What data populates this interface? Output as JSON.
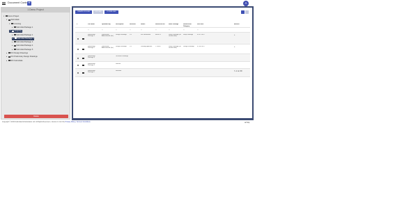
{
  "header": {
    "title": "Document Control",
    "add_label": "+",
    "avatar_initial": "A"
  },
  "tree": {
    "project_title": "1 Demo Project",
    "nodes": [
      {
        "label": "Demo Project",
        "expanded": true
      },
      {
        "label": "Submittals",
        "expanded": true
      },
      {
        "label": "Incoming",
        "expanded": true
      },
      {
        "label": "Submittal Package 1",
        "expanded": false
      },
      {
        "label": "Outgoing",
        "expanded": true,
        "selected": true
      },
      {
        "label": "Submittal Package 1",
        "expanded": false
      },
      {
        "label": "Submittal Package 2",
        "expanded": false,
        "selected": true
      },
      {
        "label": "Submittal Package 3",
        "expanded": false
      },
      {
        "label": "Submittal Package 4",
        "expanded": false
      },
      {
        "label": "Submittal Package 5",
        "expanded": false
      },
      {
        "label": "IFC Design Drawings",
        "expanded": false
      },
      {
        "label": "IFC Preliminary Design Drawings",
        "expanded": false
      },
      {
        "label": "RFI Submittals",
        "expanded": false
      }
    ],
    "delete_label": "Delete"
  },
  "toolbar": {
    "new_folder": "CREATE FOLDER",
    "upload": "UPLOAD",
    "download": "DOWNLOAD"
  },
  "table": {
    "columns": [
      "#",
      "",
      "File Name",
      "Uploaded By",
      "Description",
      "Revision",
      "Status",
      "Reference No.",
      "Work Package",
      "Submission Category",
      "Due Date",
      "Actions"
    ],
    "filter_placeholder": "Q",
    "rows": [
      {
        "name": "Submission Package 1",
        "uploaded": "Submission Administrator (Int)",
        "description": "Design Drawings",
        "revision": "1.0",
        "status": "For Information",
        "ref": "Mech 01",
        "work": "Shop Drawings (for construction)",
        "category": "Shop Drawings",
        "due": "02.07.2019",
        "actions": "+"
      },
      {
        "name": "Submission Package 2",
        "uploaded": "Submission Administrator (Int)",
        "description": "Design Drawings",
        "revision": "1.0",
        "status": "Pending approval",
        "ref": "CYR007",
        "work": "Shop Drawings (for construction)",
        "category": "Design Drawings",
        "due": "07.08.2019",
        "actions": "+"
      },
      {
        "name": "Submission Package 3",
        "uploaded": "",
        "description": "Technical Drawings",
        "revision": "",
        "status": "",
        "ref": "",
        "work": "",
        "category": "",
        "due": "",
        "actions": ""
      },
      {
        "name": "Submission Package 4",
        "uploaded": "",
        "description": "Rewrite",
        "revision": "",
        "status": "",
        "ref": "",
        "work": "",
        "category": "",
        "due": "",
        "actions": ""
      },
      {
        "name": "Submission Package 5",
        "uploaded": "",
        "description": "Sensible",
        "revision": "",
        "status": "",
        "ref": "",
        "work": "",
        "category": "",
        "due": "",
        "actions": "✎ ⊘ ⊕ ⌫"
      }
    ]
  },
  "footer": {
    "copyright": "Copyright © 2019 Submittal Administration Ltd. All Rights Reserved.",
    "version": "Version 1.0.12.34",
    "links": "Privacy Policy | Terms & Conditions",
    "help": "Help"
  },
  "colors": {
    "accent": "#3f51b5",
    "panel_border": "#3b4a72",
    "delete": "#d9534f"
  }
}
